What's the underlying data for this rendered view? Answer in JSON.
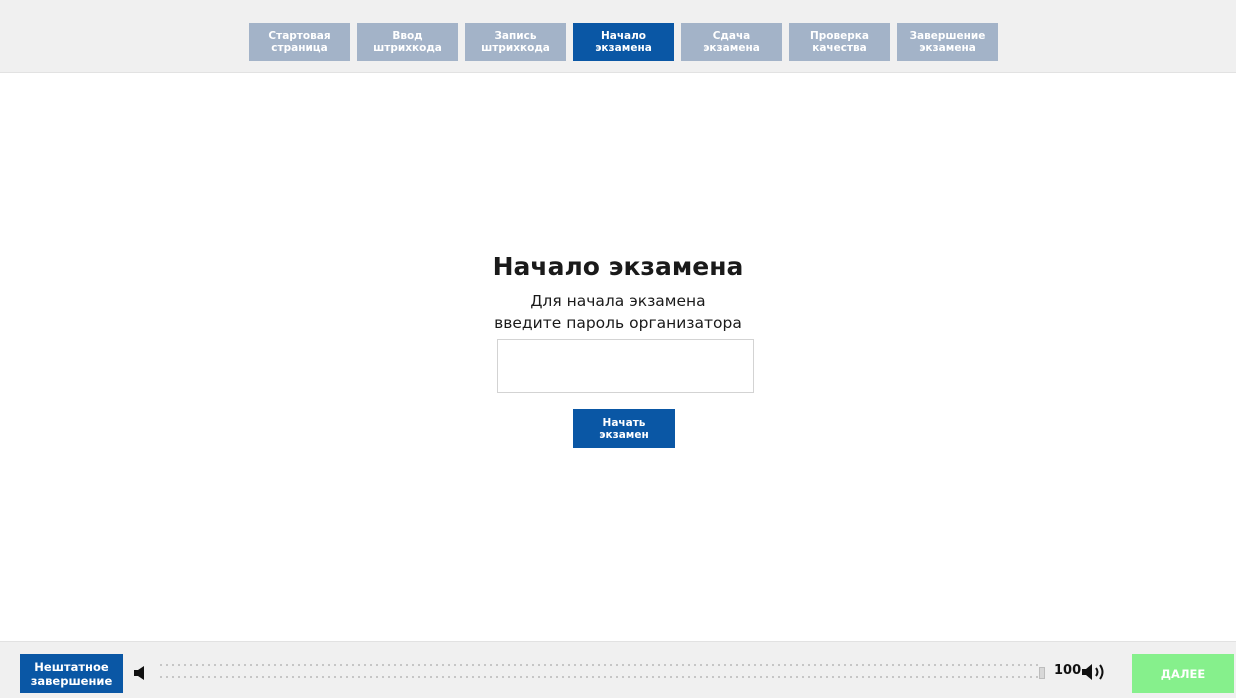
{
  "steps": [
    {
      "label": "Стартовая\nстраница",
      "active": false
    },
    {
      "label": "Ввод\nштрихкода",
      "active": false
    },
    {
      "label": "Запись\nштрихкода",
      "active": false
    },
    {
      "label": "Начало\nэкзамена",
      "active": true
    },
    {
      "label": "Сдача\nэкзамена",
      "active": false
    },
    {
      "label": "Проверка\nкачества",
      "active": false
    },
    {
      "label": "Завершение\nэкзамена",
      "active": false
    }
  ],
  "main": {
    "title": "Начало экзамена",
    "subtitle": "Для начала экзамена\nвведите пароль организатора",
    "password_value": "",
    "start_label": "Начать\nэкзамен"
  },
  "footer": {
    "abort_label": "Нештатное\nзавершение",
    "volume_value": "100",
    "volume_level_percent": 100,
    "next_label": "ДАЛЕЕ",
    "speaker_low_icon": "speaker-low-icon",
    "speaker_high_icon": "speaker-high-icon"
  },
  "colors": {
    "step_inactive": "#a3b3c8",
    "step_active": "#0a57a5",
    "primary_button": "#0a57a5",
    "next_button": "#86f08c",
    "bar_background": "#f0f0f0"
  }
}
